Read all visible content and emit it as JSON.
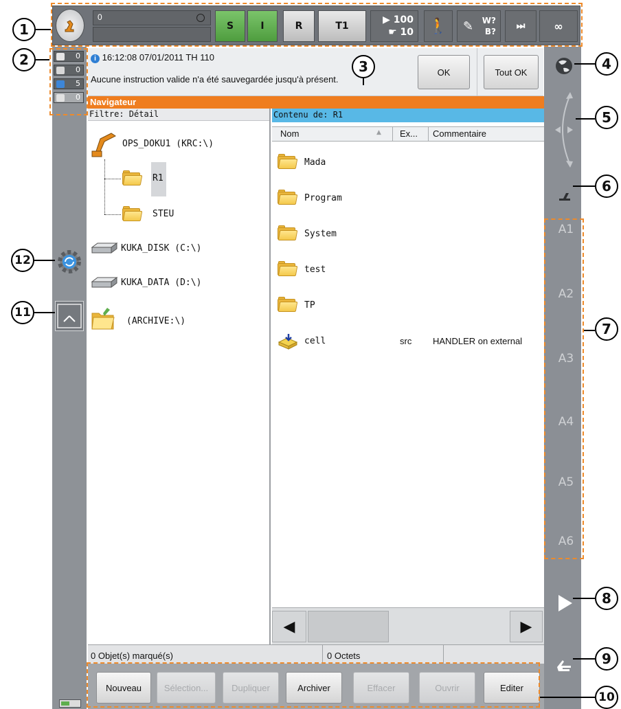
{
  "topbar": {
    "field_value": "0",
    "status_s": "S",
    "status_i": "I",
    "status_r": "R",
    "mode": "T1",
    "override_prog": "100",
    "override_jog": "10",
    "tool_w": "W?",
    "tool_b": "B?",
    "infinity": "∞"
  },
  "message_counters": [
    {
      "type": "acknowledge",
      "count": "0"
    },
    {
      "type": "status",
      "count": "0"
    },
    {
      "type": "info",
      "count": "5"
    },
    {
      "type": "wait",
      "count": "0"
    }
  ],
  "message": {
    "timestamp": "16:12:08 07/01/2011 TH 110",
    "text": "Aucune instruction valide n'a été sauvegardée jusqu'à présent.",
    "ok_label": "OK",
    "all_ok_label": "Tout OK"
  },
  "navigator": {
    "title": "Navigateur",
    "filter": "Filtre: Détail",
    "content_of": "Contenu de: R1",
    "tree": [
      {
        "label": "OPS_DOKU1 (KRC:\\)",
        "kind": "robot"
      },
      {
        "label": "R1",
        "kind": "folder"
      },
      {
        "label": "STEU",
        "kind": "folder"
      },
      {
        "label": "KUKA_DISK (C:\\)",
        "kind": "drive"
      },
      {
        "label": "KUKA_DATA (D:\\)",
        "kind": "drive"
      },
      {
        "label": "(ARCHIVE:\\)",
        "kind": "archive"
      }
    ],
    "columns": {
      "name": "Nom",
      "ext": "Ex...",
      "comment": "Commentaire"
    },
    "rows": [
      {
        "name": "Mada",
        "ext": "",
        "comment": "",
        "kind": "folder"
      },
      {
        "name": "Program",
        "ext": "",
        "comment": "",
        "kind": "folder"
      },
      {
        "name": "System",
        "ext": "",
        "comment": "",
        "kind": "folder"
      },
      {
        "name": "test",
        "ext": "",
        "comment": "",
        "kind": "folder"
      },
      {
        "name": "TP",
        "ext": "",
        "comment": "",
        "kind": "folder"
      },
      {
        "name": "cell",
        "ext": "src",
        "comment": "HANDLER on external",
        "kind": "module"
      }
    ]
  },
  "status": {
    "marked": "0 Objet(s) marqué(s)",
    "bytes": "0 Octets"
  },
  "buttons": {
    "new": "Nouveau",
    "select": "Sélection...",
    "duplicate": "Dupliquer",
    "archive": "Archiver",
    "delete": "Effacer",
    "open": "Ouvrir",
    "edit": "Editer"
  },
  "axes": [
    "A1",
    "A2",
    "A3",
    "A4",
    "A5",
    "A6"
  ],
  "callouts": [
    "1",
    "2",
    "3",
    "4",
    "5",
    "6",
    "7",
    "8",
    "9",
    "10",
    "11",
    "12"
  ],
  "colors": {
    "navigator_header": "#ef7d1f",
    "content_header": "#58b8e6",
    "status_green": "#5fae4e",
    "callout_dash": "#ee8a2a"
  }
}
